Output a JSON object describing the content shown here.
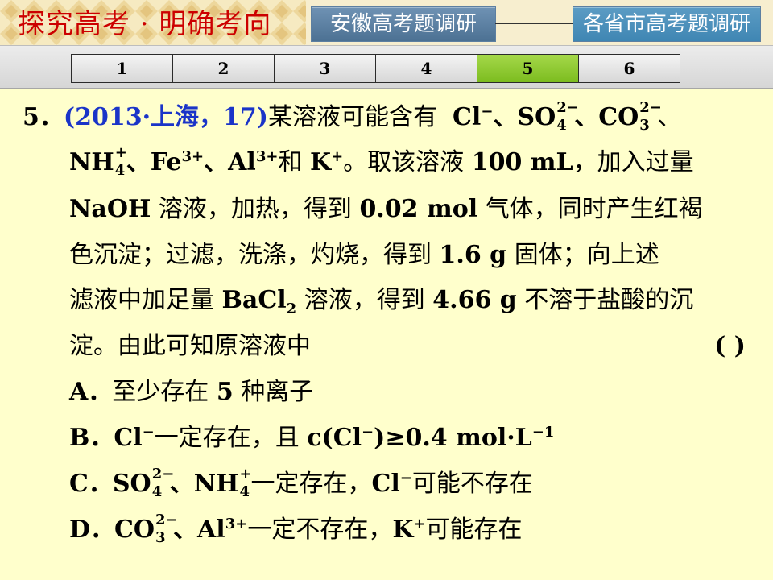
{
  "header": {
    "title": "探究高考 · 明确考向",
    "btn_anhui": "安徽高考题调研",
    "btn_provinces": "各省市高考题调研"
  },
  "tabs": [
    "1",
    "2",
    "3",
    "4",
    "5",
    "6"
  ],
  "active_tab": "5",
  "question": {
    "number": "5．",
    "source": "(2013·上海，17)",
    "line1_a": "某溶液可能含有",
    "line1_b": "Cl",
    "line1_c": "、SO",
    "line1_d": "、CO",
    "line1_e": "、",
    "line2_a": "NH",
    "line2_b": "、Fe",
    "line2_c": "、Al",
    "line2_d": "和",
    "line2_e": "K",
    "line2_f": "。取该溶液",
    "line2_g": "100 mL",
    "line2_h": "，加入过量",
    "line3_a": "NaOH",
    "line3_b": "溶液，加热，得到",
    "line3_c": "0.02 mol",
    "line3_d": "气体，同时产生红褐",
    "line4_a": "色沉淀；过滤，洗涤，灼烧，得到",
    "line4_b": "1.6 g",
    "line4_c": "固体；向上述",
    "line5_a": "滤液中加足量",
    "line5_b": "BaCl",
    "line5_c": "溶液，得到",
    "line5_d": "4.66 g",
    "line5_e": "不溶于盐酸的沉",
    "line6_a": "淀。由此可知原溶液中",
    "line6_paren": "(        )",
    "optA_label": "A．",
    "optA_a": "至少存在",
    "optA_b": "5",
    "optA_c": "种离子",
    "optB_label": "B．",
    "optB_a": "Cl",
    "optB_b": "一定存在，且",
    "optB_c": "c(Cl",
    "optB_d": ")≥0.4 mol·L",
    "optC_label": "C．",
    "optC_a": "SO",
    "optC_b": "、NH",
    "optC_c": "一定存在，",
    "optC_d": "Cl",
    "optC_e": "可能不存在",
    "optD_label": "D．",
    "optD_a": "CO",
    "optD_b": "、Al",
    "optD_c": "一定不存在，",
    "optD_d": "K",
    "optD_e": "可能存在"
  },
  "scripts": {
    "minus": "−",
    "plus": "+",
    "two_minus": "2−",
    "three_plus": "3+",
    "sub4": "4",
    "sub3": "3",
    "sub2": "2",
    "neg1": "−1"
  },
  "colors": {
    "background": "#ffffcc",
    "title_red": "#cc0000",
    "source_blue": "#1a34c8",
    "active_tab": "#8cc63f"
  }
}
